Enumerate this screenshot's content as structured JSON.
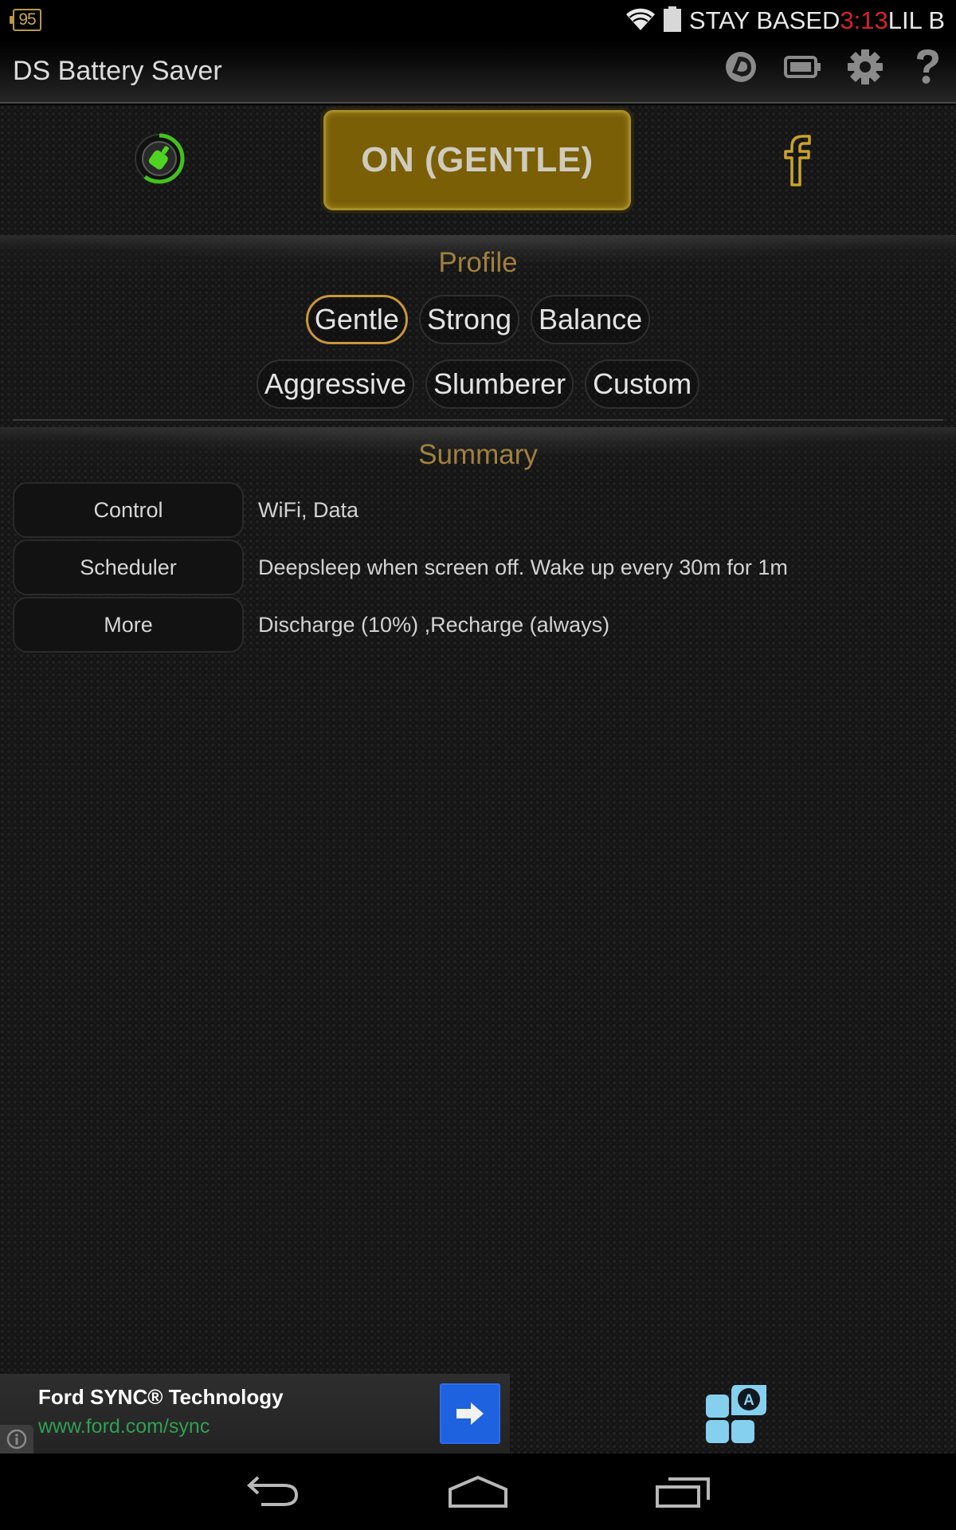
{
  "status_bar": {
    "battery_badge": "95",
    "carrier_left": "STAY BASED",
    "time": "3:13",
    "carrier_right": "LIL B",
    "icons": [
      "wifi-icon",
      "battery-icon"
    ]
  },
  "action_bar": {
    "title": "DS Battery Saver",
    "icons": [
      "widget-icon",
      "battery-icon",
      "settings-icon",
      "help-icon"
    ]
  },
  "top_row": {
    "cleaner_icon": "cleaner-icon",
    "power_button_label": "ON (GENTLE)",
    "facebook_icon": "facebook-icon"
  },
  "profile": {
    "title": "Profile",
    "selected": "Gentle",
    "options": [
      "Gentle",
      "Strong",
      "Balance",
      "Aggressive",
      "Slumberer",
      "Custom"
    ]
  },
  "summary": {
    "title": "Summary",
    "rows": [
      {
        "label": "Control",
        "value": "WiFi, Data"
      },
      {
        "label": "Scheduler",
        "value": "Deepsleep when screen off. Wake up every 30m for 1m"
      },
      {
        "label": "More",
        "value": "Discharge (10%) ,Recharge (always)"
      }
    ]
  },
  "ad": {
    "title": "Ford SYNC® Technology",
    "url": "www.ford.com/sync",
    "info_icon": "info-icon",
    "go_icon": "arrow-right-icon"
  },
  "nav_bar": {
    "icons": [
      "back-icon",
      "home-icon",
      "recents-icon"
    ]
  },
  "colors": {
    "accent_gold": "#a0803e",
    "power_button": "#7a5f07",
    "active_chip_border": "#c9973a",
    "time_red": "#d6232a",
    "ad_url_green": "#2fa052",
    "ad_button_blue": "#1e62e0",
    "tiles_blue": "#85d0ef"
  }
}
